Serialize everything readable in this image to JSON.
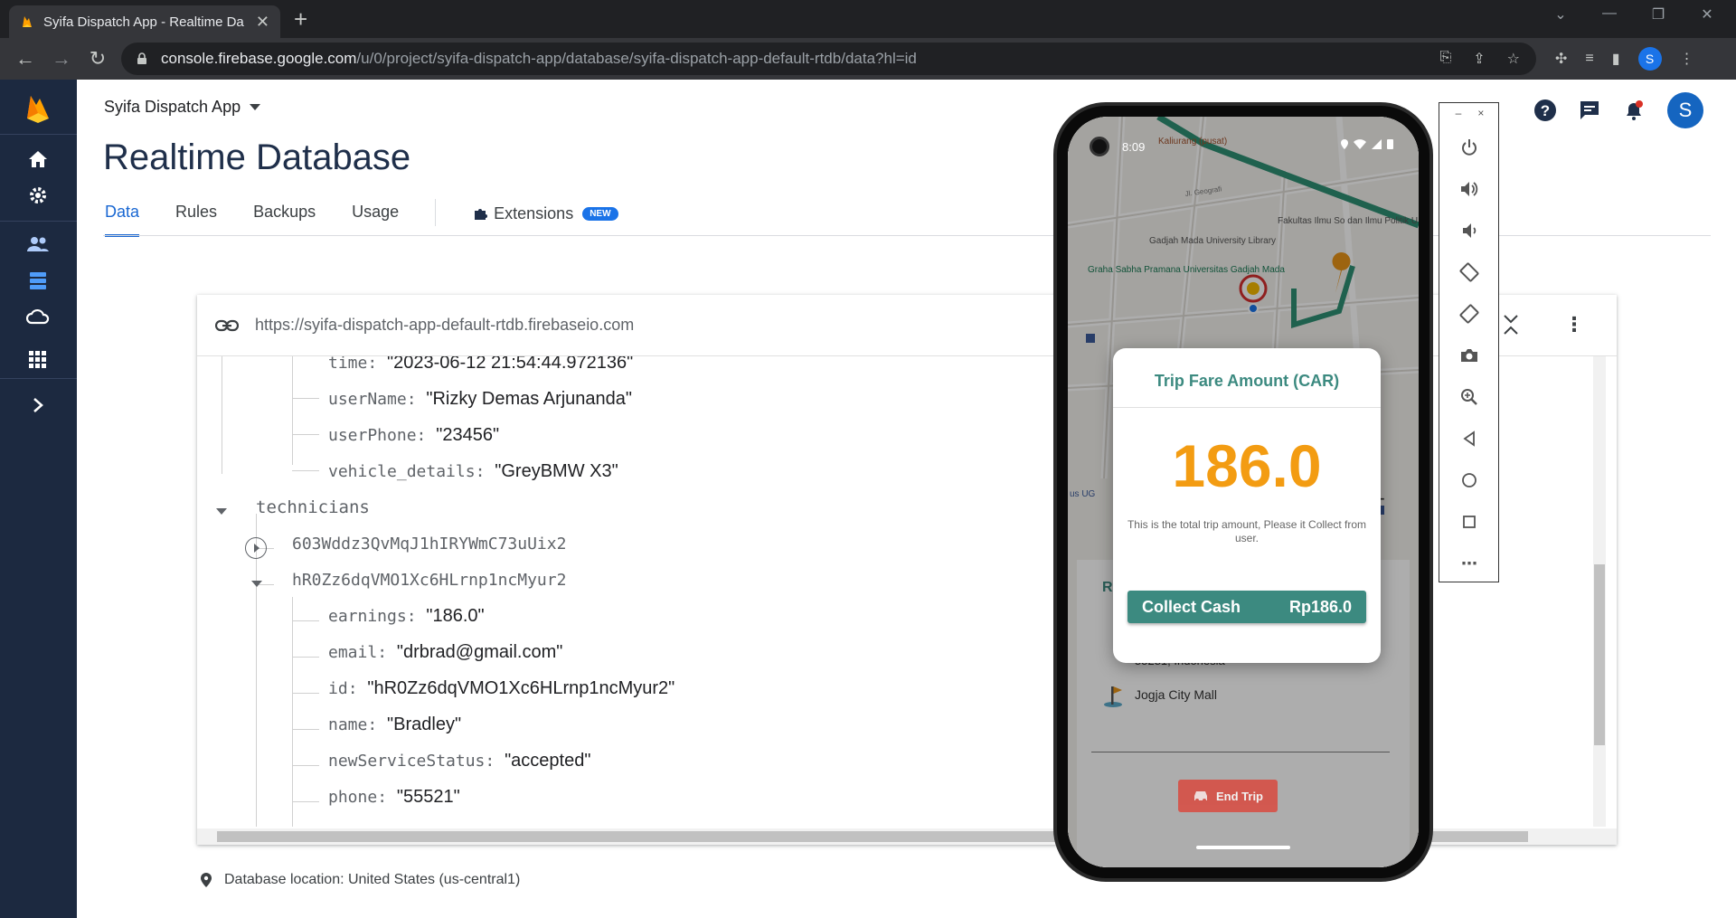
{
  "browser": {
    "tab_title": "Syifa Dispatch App - Realtime Da",
    "url_host": "console.firebase.google.com",
    "url_path": "/u/0/project/syifa-dispatch-app/database/syifa-dispatch-app-default-rtdb/data?hl=id",
    "profile_initial": "S"
  },
  "firebase": {
    "project_name": "Syifa Dispatch App",
    "page_title": "Realtime Database",
    "tabs": [
      "Data",
      "Rules",
      "Backups",
      "Usage"
    ],
    "extensions_label": "Extensions",
    "new_badge": "NEW",
    "db_url": "https://syifa-dispatch-app-default-rtdb.firebaseio.com",
    "db_location": "Database location: United States (us-central1)",
    "avatar_initial": "S"
  },
  "tree": {
    "rows": [
      {
        "key": "time",
        "value": "\"2023-06-12 21:54:44.972136\""
      },
      {
        "key": "userName",
        "value": "\"Rizky Demas Arjunanda\""
      },
      {
        "key": "userPhone",
        "value": "\"23456\""
      },
      {
        "key": "vehicle_details",
        "value": "\"GreyBMW X3\""
      },
      {
        "key": "technicians",
        "value": ""
      },
      {
        "key": "603Wddz3QvMqJ1hIRYWmC73uUix2",
        "value": ""
      },
      {
        "key": "hR0Zz6dqVMO1Xc6HLrnp1ncMyur2",
        "value": ""
      },
      {
        "key": "earnings",
        "value": "\"186.0\""
      },
      {
        "key": "email",
        "value": "\"drbrad@gmail.com\""
      },
      {
        "key": "id",
        "value": "\"hR0Zz6dqVMO1Xc6HLrnp1ncMyur2\""
      },
      {
        "key": "name",
        "value": "\"Bradley\""
      },
      {
        "key": "newServiceStatus",
        "value": "\"accepted\""
      },
      {
        "key": "phone",
        "value": "\"55521\""
      }
    ]
  },
  "phone": {
    "clock": "8:09",
    "map_labels": {
      "kaliurang": "Kaliurang (pusat)",
      "geografi": "Jl. Geografi",
      "fakultas": "Fakultas Ilmu So dan Ilmu Politik U",
      "library": "Gadjah Mada University Library",
      "graha": "Graha Sabha Pramana Universitas Gadjah Mada",
      "ug": "us UG"
    },
    "dialog": {
      "title": "Trip Fare Amount (CAR)",
      "amount": "186.0",
      "note": "This is the total trip amount, Please it Collect from user.",
      "button_label": "Collect Cash",
      "button_amount": "Rp186.0"
    },
    "sheet": {
      "address_tail": "55281, Indonesia",
      "destination": "Jogja City Mall",
      "end_trip": "End Trip",
      "partial_heading": "Ri"
    }
  },
  "colors": {
    "accent_teal": "#3c8a80",
    "fare_orange": "#f39c12",
    "end_trip_red": "#d94a3f",
    "firebase_blue": "#1967d2",
    "rail_navy": "#1c2940"
  }
}
